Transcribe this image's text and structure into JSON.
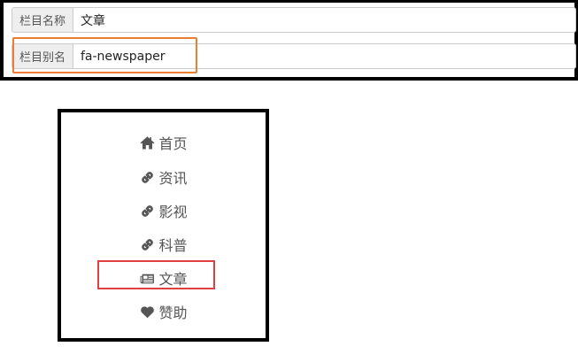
{
  "form": {
    "column_name": {
      "label": "栏目名称",
      "value": "文章"
    },
    "column_alias": {
      "label": "栏目别名",
      "value": "fa-newspaper"
    }
  },
  "nav": {
    "items": [
      {
        "label": "首页",
        "icon": "home-icon"
      },
      {
        "label": "资讯",
        "icon": "link-icon"
      },
      {
        "label": "影视",
        "icon": "link-icon"
      },
      {
        "label": "科普",
        "icon": "link-icon"
      },
      {
        "label": "文章",
        "icon": "newspaper-icon",
        "highlighted": true
      },
      {
        "label": "赞助",
        "icon": "heart-icon"
      }
    ]
  },
  "colors": {
    "highlight_orange": "#ed7d31",
    "highlight_red": "#e04040",
    "icon_gray": "#555555",
    "label_bg": "#eeeeee"
  }
}
